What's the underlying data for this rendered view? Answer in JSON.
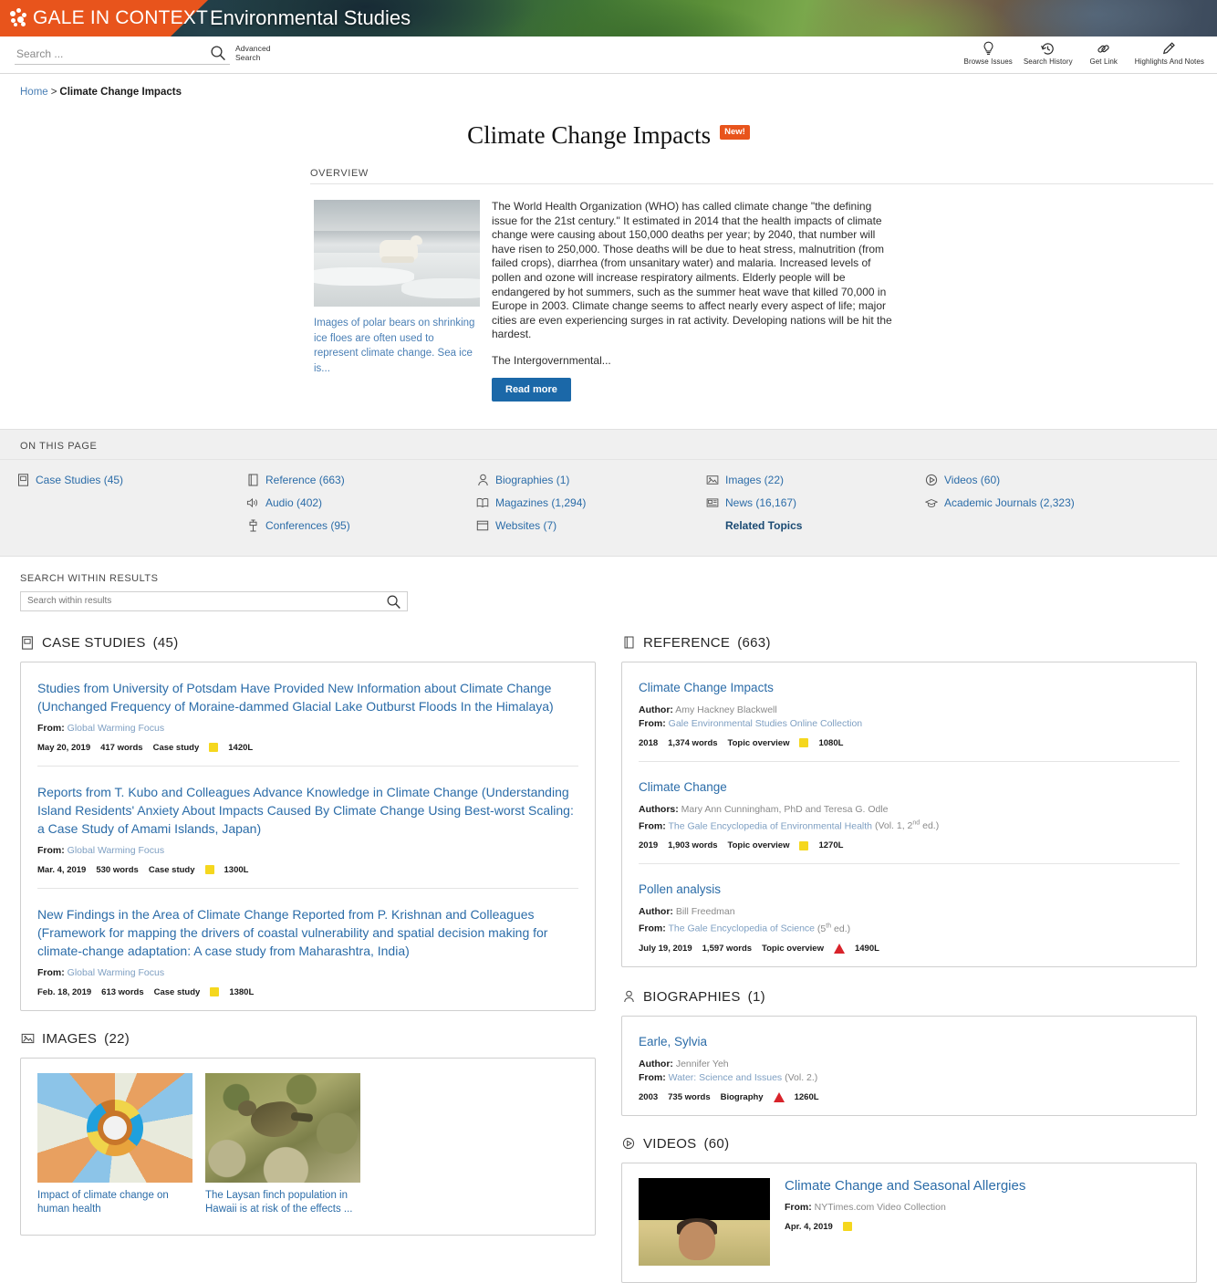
{
  "header": {
    "brand": "GALE IN CONTEXT",
    "product": "Environmental Studies",
    "brand_color": "#e8541c"
  },
  "toolbar": {
    "search_placeholder": "Search ...",
    "search_value": "",
    "advanced_search_line1": "Advanced",
    "advanced_search_line2": "Search",
    "tools": [
      {
        "label": "Browse Issues",
        "icon": "lightbulb-icon"
      },
      {
        "label": "Search History",
        "icon": "history-icon"
      },
      {
        "label": "Get Link",
        "icon": "link-icon"
      },
      {
        "label": "Highlights And Notes",
        "icon": "highlighter-icon"
      }
    ]
  },
  "breadcrumb": {
    "home": "Home",
    "separator": ">",
    "current": "Climate Change Impacts"
  },
  "topic": {
    "title": "Climate Change Impacts",
    "badge": "New!"
  },
  "overview": {
    "label": "OVERVIEW",
    "image_caption": "Images of polar bears on shrinking ice floes are often used to represent climate change. Sea ice is...",
    "paragraph": "The World Health Organization (WHO) has called climate change \"the defining issue for the 21st century.\" It estimated in 2014 that the health impacts of climate change were causing about 150,000 deaths per year; by 2040, that number will have risen to 250,000. Those deaths will be due to heat stress, malnutrition (from failed crops), diarrhea (from unsanitary water) and malaria. Increased levels of pollen and ozone will increase respiratory ailments. Elderly people will be endangered by hot summers, such as the summer heat wave that killed 70,000 in Europe in 2003. Climate change seems to affect nearly every aspect of life; major cities are even experiencing surges in rat activity. Developing nations will be hit the hardest.",
    "truncated_line": "The Intergovernmental...",
    "read_more": "Read more"
  },
  "on_this_page": {
    "label": "ON THIS PAGE",
    "col1": [
      {
        "label": "Case Studies (45)",
        "icon": "case-study-icon"
      }
    ],
    "col2": [
      {
        "label": "Reference (663)",
        "icon": "reference-book-icon"
      },
      {
        "label": "Audio (402)",
        "icon": "audio-icon"
      },
      {
        "label": "Conferences (95)",
        "icon": "podium-icon"
      }
    ],
    "col3": [
      {
        "label": "Biographies (1)",
        "icon": "person-icon"
      },
      {
        "label": "Magazines (1,294)",
        "icon": "magazine-icon"
      },
      {
        "label": "Websites (7)",
        "icon": "website-icon"
      }
    ],
    "col4": [
      {
        "label": "Images (22)",
        "icon": "image-icon"
      },
      {
        "label": "News (16,167)",
        "icon": "news-icon"
      },
      {
        "label": "Related Topics",
        "icon": "none"
      }
    ],
    "col5": [
      {
        "label": "Videos (60)",
        "icon": "video-play-icon"
      },
      {
        "label": "Academic Journals (2,323)",
        "icon": "graduation-cap-icon"
      }
    ]
  },
  "search_within": {
    "label": "SEARCH WITHIN RESULTS",
    "placeholder": "Search within results",
    "value": ""
  },
  "sections": {
    "case_studies": {
      "heading": "CASE STUDIES",
      "count": "(45)",
      "icon": "case-study-icon",
      "entries": [
        {
          "title": "Studies from University of Potsdam Have Provided New Information about Climate Change (Unchanged Frequency of Moraine-dammed Glacial Lake Outburst Floods In the Himalaya)",
          "from_label": "From:",
          "source": "Global Warming Focus",
          "date": "May 20, 2019",
          "words": "417 words",
          "type": "Case study",
          "lexile_color": "yellow",
          "lexile": "1420L"
        },
        {
          "title": "Reports from T. Kubo and Colleagues Advance Knowledge in Climate Change (Understanding Island Residents' Anxiety About Impacts Caused By Climate Change Using Best-worst Scaling: a Case Study of Amami Islands, Japan)",
          "from_label": "From:",
          "source": "Global Warming Focus",
          "date": "Mar. 4, 2019",
          "words": "530 words",
          "type": "Case study",
          "lexile_color": "yellow",
          "lexile": "1300L"
        },
        {
          "title": "New Findings in the Area of Climate Change Reported from P. Krishnan and Colleagues (Framework for mapping the drivers of coastal vulnerability and spatial decision making for climate-change adaptation: A case study from Maharashtra, India)",
          "from_label": "From:",
          "source": "Global Warming Focus",
          "date": "Feb. 18, 2019",
          "words": "613 words",
          "type": "Case study",
          "lexile_color": "yellow",
          "lexile": "1380L"
        }
      ]
    },
    "images": {
      "heading": "IMAGES",
      "count": "(22)",
      "icon": "image-icon",
      "tiles": [
        {
          "caption": "Impact of climate change on human health",
          "art": "wheel"
        },
        {
          "caption": "The Laysan finch population in Hawaii is at risk of the effects ...",
          "art": "finch"
        }
      ]
    },
    "reference": {
      "heading": "REFERENCE",
      "count": "(663)",
      "icon": "reference-book-icon",
      "entries": [
        {
          "title": "Climate Change Impacts",
          "author_label": "Author:",
          "author": "Amy Hackney Blackwell",
          "from_label": "From:",
          "source": "Gale Environmental Studies Online Collection",
          "source_suffix": "",
          "date": "2018",
          "words": "1,374 words",
          "type": "Topic overview",
          "lexile_color": "yellow",
          "lexile": "1080L"
        },
        {
          "title": "Climate Change",
          "author_label": "Authors:",
          "author": "Mary Ann Cunningham, PhD and Teresa G. Odle",
          "from_label": "From:",
          "source": "The Gale Encyclopedia of Environmental Health",
          "source_suffix": "(Vol. 1, 2nd ed.)",
          "suffix_sup": "nd",
          "date": "2019",
          "words": "1,903 words",
          "type": "Topic overview",
          "lexile_color": "yellow",
          "lexile": "1270L"
        },
        {
          "title": "Pollen analysis",
          "author_label": "Author:",
          "author": "Bill Freedman",
          "from_label": "From:",
          "source": "The Gale Encyclopedia of Science",
          "source_suffix": "(5th ed.)",
          "suffix_sup": "th",
          "date": "July 19, 2019",
          "words": "1,597 words",
          "type": "Topic overview",
          "lexile_color": "red",
          "lexile": "1490L"
        }
      ]
    },
    "biographies": {
      "heading": "BIOGRAPHIES",
      "count": "(1)",
      "icon": "person-icon",
      "entries": [
        {
          "title": "Earle, Sylvia",
          "author_label": "Author:",
          "author": "Jennifer Yeh",
          "from_label": "From:",
          "source": "Water: Science and Issues",
          "source_suffix": "(Vol. 2.)",
          "date": "2003",
          "words": "735 words",
          "type": "Biography",
          "lexile_color": "red",
          "lexile": "1260L"
        }
      ]
    },
    "videos": {
      "heading": "VIDEOS",
      "count": "(60)",
      "icon": "video-play-icon",
      "entries": [
        {
          "title": "Climate Change and Seasonal Allergies",
          "from_label": "From:",
          "source": "NYTimes.com Video Collection",
          "date": "Apr. 4, 2019",
          "lexile_color": "yellow"
        }
      ]
    }
  }
}
